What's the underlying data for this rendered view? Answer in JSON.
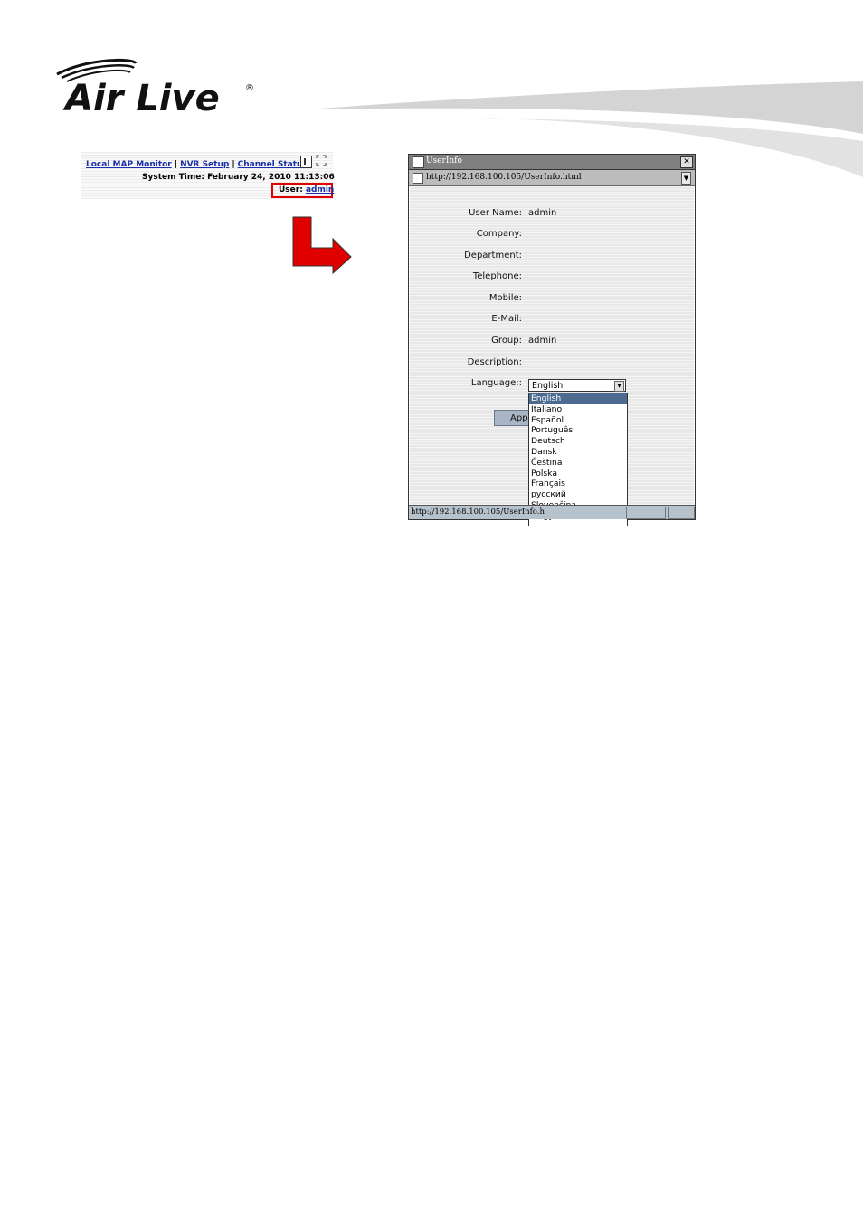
{
  "header": {
    "logo_text": "Air Live",
    "registered_mark": "®"
  },
  "nvr_bar": {
    "links": [
      "Local MAP Monitor",
      "NVR Setup",
      "Channel Status"
    ],
    "separator": "|",
    "system_time_label": "System Time:",
    "system_time_value": "February 24, 2010 11:13:06",
    "user_label": "User:",
    "user_value": "admin"
  },
  "window": {
    "title": "UserInfo",
    "address": "http://192.168.100.105/UserInfo.html",
    "close_glyph": "✕",
    "status_text": "http://192.168.100.105/UserInfo.h",
    "fields": [
      {
        "label": "User Name:",
        "value": "admin"
      },
      {
        "label": "Company:",
        "value": ""
      },
      {
        "label": "Department:",
        "value": ""
      },
      {
        "label": "Telephone:",
        "value": ""
      },
      {
        "label": "Mobile:",
        "value": ""
      },
      {
        "label": "E-Mail:",
        "value": ""
      },
      {
        "label": "Group:",
        "value": "admin"
      },
      {
        "label": "Description:",
        "value": ""
      }
    ],
    "language_label": "Language::",
    "language_selected": "English",
    "apply_label": "Apply",
    "language_options": [
      "English",
      "Italiano",
      "Español",
      "Português",
      "Deutsch",
      "Dansk",
      "Čeština",
      "Polska",
      "Français",
      "русский",
      "Slovenčina",
      "Magyar"
    ]
  },
  "colors": {
    "link": "#1a2fa8",
    "highlight_box": "#e00000",
    "arrow": "#e00000",
    "selected_option": "#4d6a8f"
  }
}
